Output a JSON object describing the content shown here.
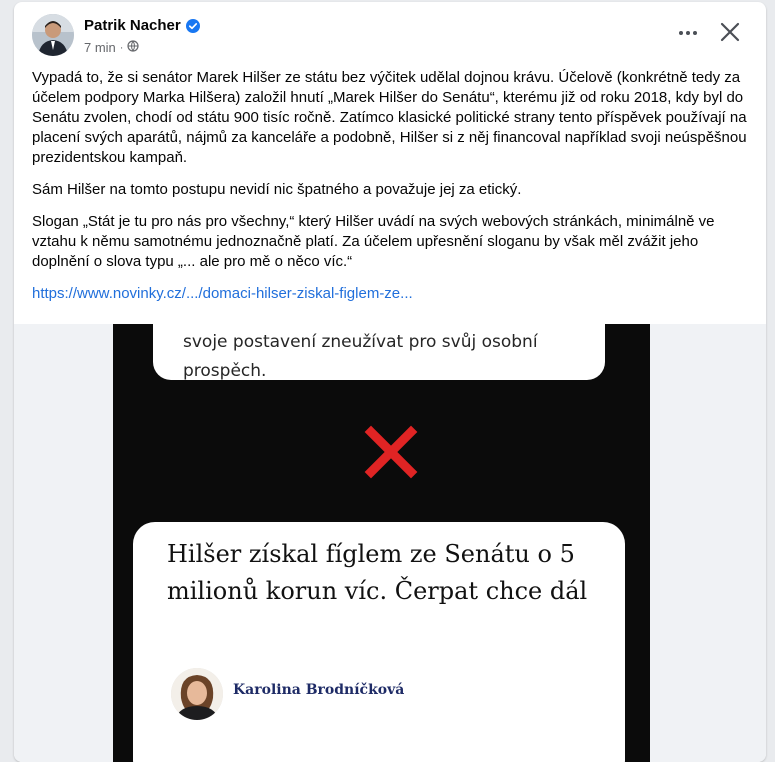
{
  "post": {
    "author": "Patrik Nacher",
    "time": "7 min",
    "paragraphs": [
      "Vypadá to, že si senátor Marek Hilšer ze státu bez výčitek udělal dojnou krávu. Účelově (konkrétně tedy za účelem podpory Marka Hilšera) založil hnutí „Marek Hilšer do Senátu“, kterému již od roku 2018, kdy byl do Senátu zvolen, chodí od státu 900 tisíc ročně. Zatímco klasické politické strany tento příspěvek používají na placení svých aparátů, nájmů za kanceláře a podobně, Hilšer si z něj financoval například svoji neúspěšnou prezidentskou kampaň.",
      "Sám Hilšer na tomto postupu nevidí nic špatného a považuje jej za etický.",
      "Slogan „Stát je tu pro nás pro všechny,“ který Hilšer uvádí na svých webových stránkách, minimálně ve vztahu k němu samotnému jednoznačně platí. Za účelem upřesnění sloganu by však měl zvážit jeho doplnění o slova typu „... ale pro mě o něco víc.“"
    ],
    "link": "https://www.novinky.cz/.../domaci-hilser-ziskal-figlem-ze..."
  },
  "image": {
    "top_card_lines": [
      "svoje postavení zneužívat pro svůj osobní",
      "prospěch."
    ],
    "article_title": "Hilšer získal fíglem ze Senátu o 5 milionů korun víc. Čerpat chce dál",
    "reporter": "Karolina Brodníčková"
  },
  "icons": {
    "verified": "verified-badge-icon",
    "privacy": "globe-icon",
    "more": "more-options-icon",
    "close": "close-icon",
    "cross": "red-x-icon"
  },
  "colors": {
    "link": "#216fdb",
    "verified": "#1877f2",
    "cross": "#e02424",
    "reporter": "#1e2b66"
  }
}
